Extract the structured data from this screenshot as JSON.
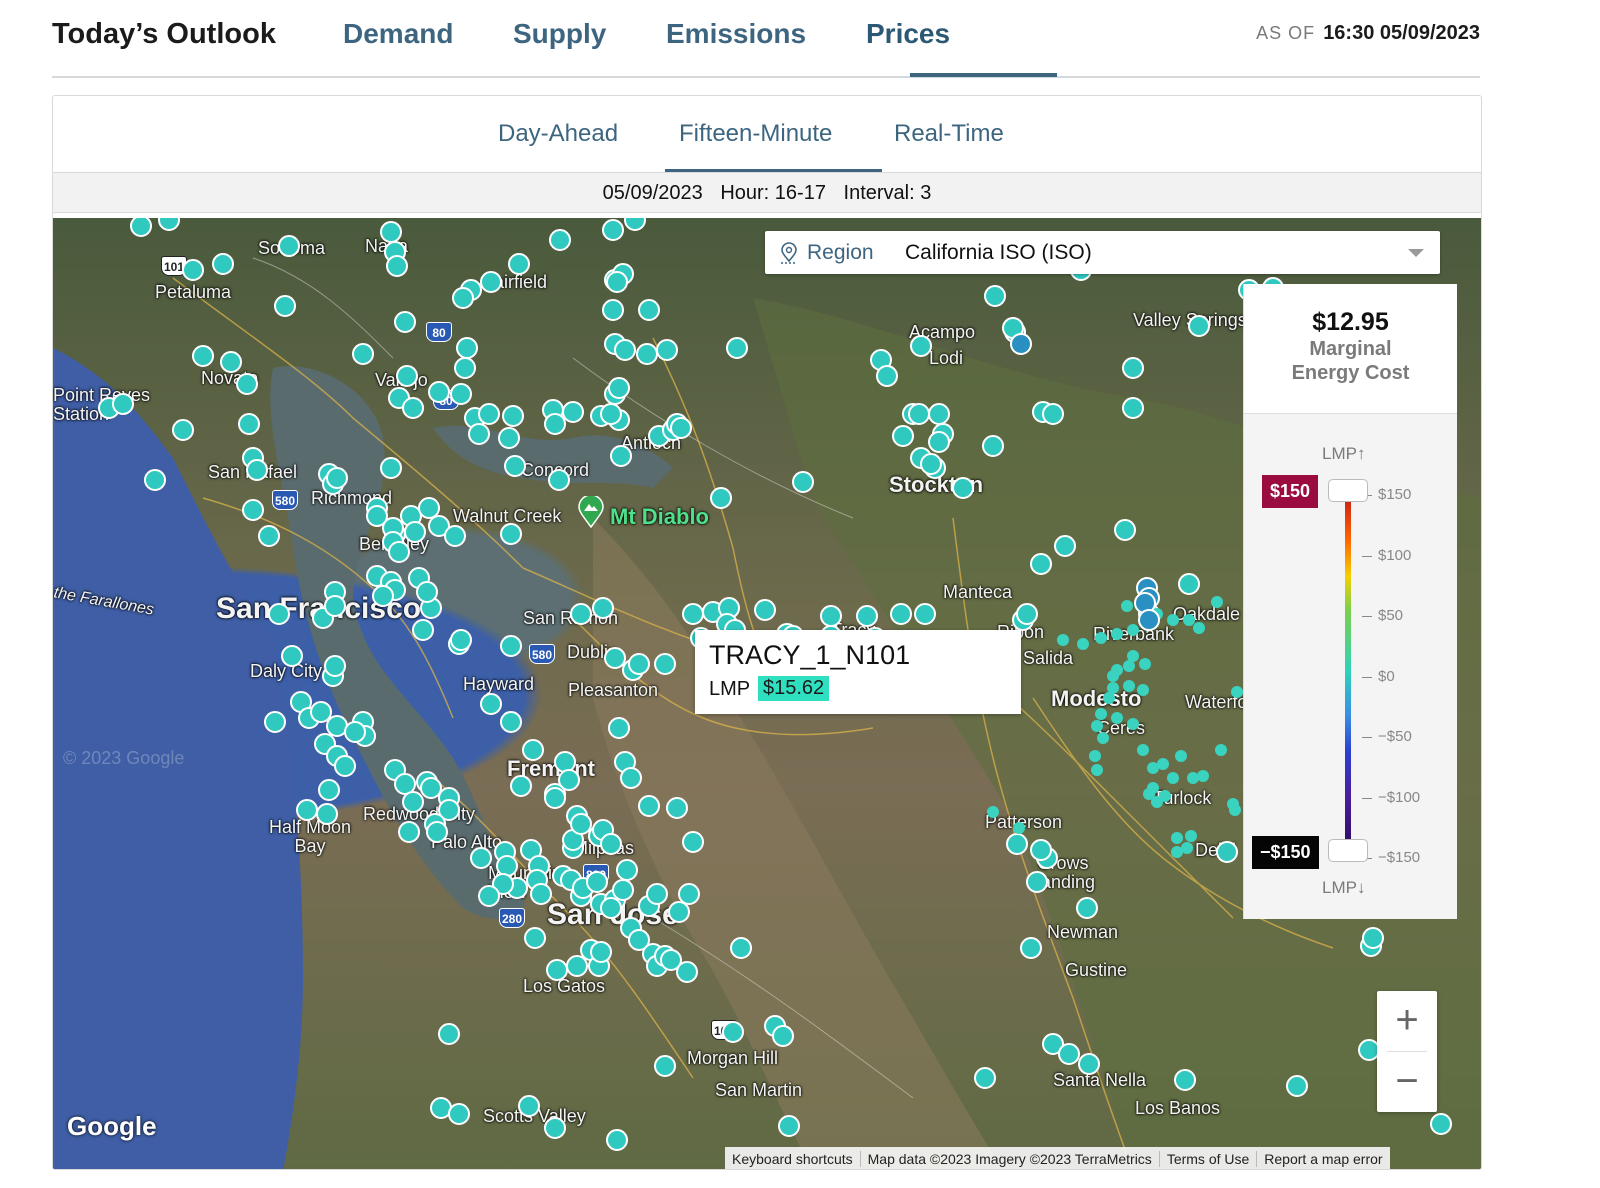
{
  "header": {
    "title": "Today’s Outlook",
    "tabs": [
      "Demand",
      "Supply",
      "Emissions",
      "Prices"
    ],
    "active_tab": "Prices",
    "as_of_label": "AS OF",
    "as_of_value": "16:30 05/09/2023"
  },
  "subtabs": [
    "Day-Ahead",
    "Fifteen-Minute",
    "Real-Time"
  ],
  "active_subtab": "Fifteen-Minute",
  "interval": {
    "date": "05/09/2023",
    "hour": "Hour: 16-17",
    "interval": "Interval: 3"
  },
  "region": {
    "label": "Region",
    "value": "California ISO (ISO)"
  },
  "tooltip": {
    "node": "TRACY_1_N101",
    "lmp_label": "LMP",
    "lmp_value": "$15.62"
  },
  "legend": {
    "marginal_value": "$12.95",
    "marginal_label_1": "Marginal",
    "marginal_label_2": "Energy Cost",
    "lmp_up": "LMP↑",
    "lmp_down": "LMP↓",
    "max_badge": "$150",
    "min_badge": "−$150",
    "ticks": [
      "$150",
      "$100",
      "$50",
      "$0",
      "−$50",
      "−$100",
      "−$150"
    ],
    "max_value": 150,
    "min_value": -150
  },
  "map_labels": {
    "san_francisco": "San Francisco",
    "fremont": "Fremont",
    "san_jose": "San Jose",
    "stockton": "Stockton",
    "modesto": "Modesto",
    "mt_diablo": "Mt Diablo",
    "petaluma": "Petaluma",
    "sonoma": "Sonoma",
    "napa": "Napa",
    "novato": "Novato",
    "vallejo": "Vallejo",
    "point_reyes": "Point Reyes Station",
    "san_rafael": "San Rafael",
    "richmond": "Richmond",
    "berkeley": "Berkeley",
    "walnut_creek": "Walnut Creek",
    "concord": "Concord",
    "antioch": "Antioch",
    "fairfield": "Fairfield",
    "lodi": "Lodi",
    "acampo": "Acampo",
    "valley_springs": "Valley Springs",
    "san_ramon": "San Ramon",
    "dublin": "Dublin",
    "pleasanton": "Pleasanton",
    "hayward": "Hayward",
    "daly_city": "Daly City",
    "half_moon_bay": "Half Moon Bay",
    "redwood_city": "Redwood City",
    "palo_alto": "Palo Alto",
    "mountain_view": "Mountain View",
    "milpitas": "Milpitas",
    "los_gatos": "Los Gatos",
    "morgan_hill": "Morgan Hill",
    "san_martin": "San Martin",
    "scotts_valley": "Scotts Valley",
    "tracy": "Tracy",
    "manteca": "Manteca",
    "ripon": "Ripon",
    "salida": "Salida",
    "riverbank": "Riverbank",
    "oakdale": "Oakdale",
    "waterford": "Waterford",
    "ceres": "Ceres",
    "turlock": "Turlock",
    "delhi": "Delhi",
    "patterson": "Patterson",
    "crows_landing": "Crows Landing",
    "newman": "Newman",
    "gustine": "Gustine",
    "santa_nella": "Santa Nella",
    "los_banos": "Los Banos",
    "farallones": "the Farallones",
    "watermark": "© 2023 Google"
  },
  "map_footer": {
    "google": "Google",
    "keyboard": "Keyboard shortcuts",
    "mapdata": "Map data ©2023 Imagery ©2023 TerraMetrics",
    "terms": "Terms of Use",
    "report": "Report a map error"
  },
  "zoom": {
    "in": "+",
    "out": "−"
  },
  "colors": {
    "accent": "#3d6580",
    "node": "#2fc9c0",
    "tooltip_lmp": "#2ee0c0",
    "badge_max": "#9a0b3f",
    "badge_min": "#050505"
  }
}
